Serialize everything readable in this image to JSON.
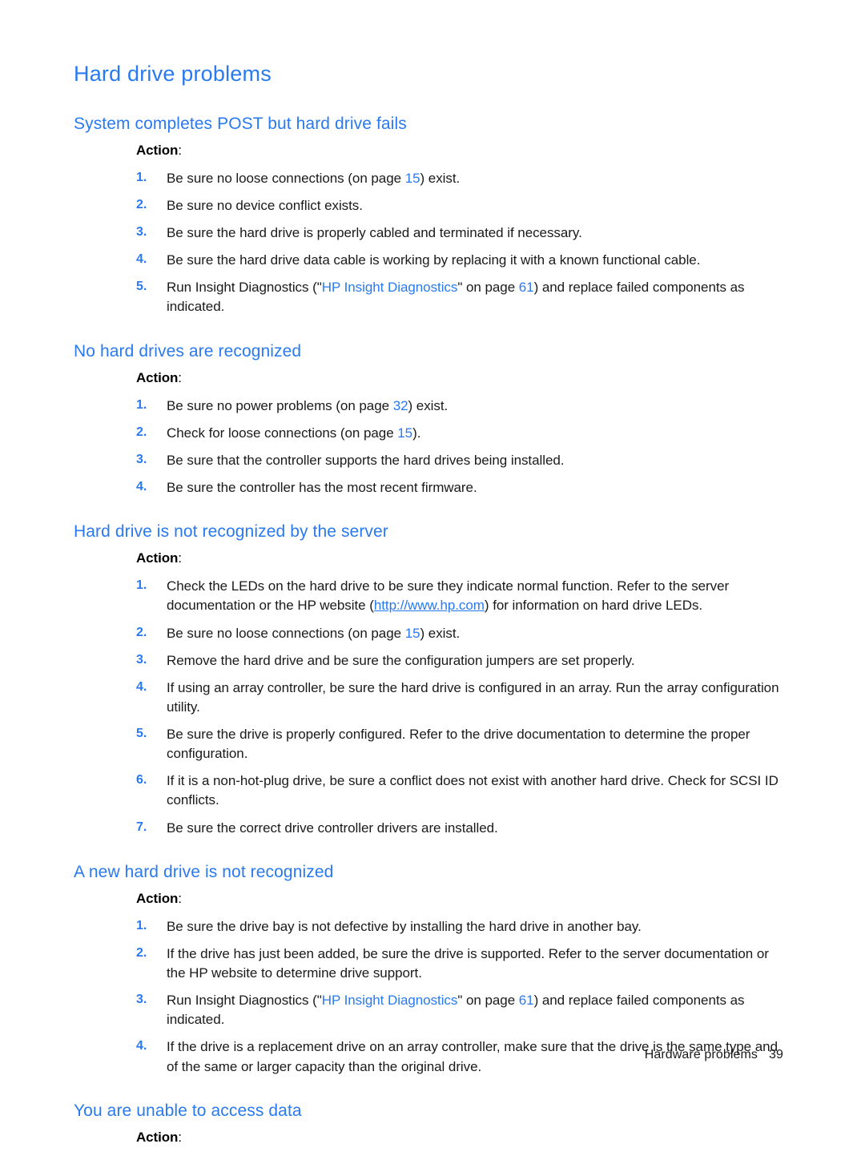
{
  "page": {
    "title": "Hard drive problems",
    "accent_color": "#2979F0",
    "text_color": "#1a1a1a",
    "background": "#ffffff"
  },
  "footer": {
    "chapter": "Hardware problems",
    "page_number": "39"
  },
  "labels": {
    "action": "Action",
    "action_colon": ":"
  },
  "sections": [
    {
      "heading": "System completes POST but hard drive fails",
      "steps": [
        {
          "num": "1.",
          "parts": [
            {
              "t": "text",
              "v": "Be sure no loose connections (on page "
            },
            {
              "t": "pagelink",
              "v": "15"
            },
            {
              "t": "text",
              "v": ") exist."
            }
          ]
        },
        {
          "num": "2.",
          "parts": [
            {
              "t": "text",
              "v": "Be sure no device conflict exists."
            }
          ]
        },
        {
          "num": "3.",
          "parts": [
            {
              "t": "text",
              "v": "Be sure the hard drive is properly cabled and terminated if necessary."
            }
          ]
        },
        {
          "num": "4.",
          "parts": [
            {
              "t": "text",
              "v": "Be sure the hard drive data cable is working by replacing it with a known functional cable."
            }
          ]
        },
        {
          "num": "5.",
          "parts": [
            {
              "t": "text",
              "v": "Run Insight Diagnostics (\""
            },
            {
              "t": "xref",
              "v": "HP Insight Diagnostics"
            },
            {
              "t": "text",
              "v": "\" on page "
            },
            {
              "t": "pagelink",
              "v": "61"
            },
            {
              "t": "text",
              "v": ") and replace failed components as indicated."
            }
          ]
        }
      ]
    },
    {
      "heading": "No hard drives are recognized",
      "steps": [
        {
          "num": "1.",
          "parts": [
            {
              "t": "text",
              "v": "Be sure no power problems (on page "
            },
            {
              "t": "pagelink",
              "v": "32"
            },
            {
              "t": "text",
              "v": ") exist."
            }
          ]
        },
        {
          "num": "2.",
          "parts": [
            {
              "t": "text",
              "v": "Check for loose connections (on page "
            },
            {
              "t": "pagelink",
              "v": "15"
            },
            {
              "t": "text",
              "v": ")."
            }
          ]
        },
        {
          "num": "3.",
          "parts": [
            {
              "t": "text",
              "v": "Be sure that the controller supports the hard drives being installed."
            }
          ]
        },
        {
          "num": "4.",
          "parts": [
            {
              "t": "text",
              "v": "Be sure the controller has the most recent firmware."
            }
          ]
        }
      ]
    },
    {
      "heading": "Hard drive is not recognized by the server",
      "steps": [
        {
          "num": "1.",
          "parts": [
            {
              "t": "text",
              "v": "Check the LEDs on the hard drive to be sure they indicate normal function. Refer to the server documentation or the HP website ("
            },
            {
              "t": "weblink",
              "v": "http://www.hp.com"
            },
            {
              "t": "text",
              "v": ") for information on hard drive LEDs."
            }
          ]
        },
        {
          "num": "2.",
          "parts": [
            {
              "t": "text",
              "v": "Be sure no loose connections (on page "
            },
            {
              "t": "pagelink",
              "v": "15"
            },
            {
              "t": "text",
              "v": ") exist."
            }
          ]
        },
        {
          "num": "3.",
          "parts": [
            {
              "t": "text",
              "v": "Remove the hard drive and be sure the configuration jumpers are set properly."
            }
          ]
        },
        {
          "num": "4.",
          "parts": [
            {
              "t": "text",
              "v": "If using an array controller, be sure the hard drive is configured in an array. Run the array configuration utility."
            }
          ]
        },
        {
          "num": "5.",
          "parts": [
            {
              "t": "text",
              "v": "Be sure the drive is properly configured. Refer to the drive documentation to determine the proper configuration."
            }
          ]
        },
        {
          "num": "6.",
          "parts": [
            {
              "t": "text",
              "v": "If it is a non-hot-plug drive, be sure a conflict does not exist with another hard drive. Check for SCSI ID conflicts."
            }
          ]
        },
        {
          "num": "7.",
          "parts": [
            {
              "t": "text",
              "v": "Be sure the correct drive controller drivers are installed."
            }
          ]
        }
      ]
    },
    {
      "heading": "A new hard drive is not recognized",
      "steps": [
        {
          "num": "1.",
          "parts": [
            {
              "t": "text",
              "v": "Be sure the drive bay is not defective by installing the hard drive in another bay."
            }
          ]
        },
        {
          "num": "2.",
          "parts": [
            {
              "t": "text",
              "v": "If the drive has just been added, be sure the drive is supported. Refer to the server documentation or the HP website to determine drive support."
            }
          ]
        },
        {
          "num": "3.",
          "parts": [
            {
              "t": "text",
              "v": "Run Insight Diagnostics (\""
            },
            {
              "t": "xref",
              "v": "HP Insight Diagnostics"
            },
            {
              "t": "text",
              "v": "\" on page "
            },
            {
              "t": "pagelink",
              "v": "61"
            },
            {
              "t": "text",
              "v": ") and replace failed components as indicated."
            }
          ]
        },
        {
          "num": "4.",
          "parts": [
            {
              "t": "text",
              "v": "If the drive is a replacement drive on an array controller, make sure that the drive is the same type and of the same or larger capacity than the original drive."
            }
          ]
        }
      ]
    },
    {
      "heading": "You are unable to access data",
      "steps": []
    }
  ]
}
